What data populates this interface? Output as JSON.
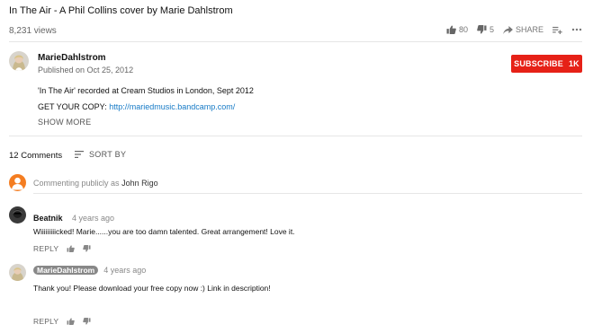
{
  "video": {
    "title": "In The Air - A Phil Collins cover by Marie Dahlstrom",
    "views": "8,231 views",
    "likes": "80",
    "dislikes": "5",
    "share_label": "SHARE",
    "add_icon": "playlist-add-icon",
    "more_icon": "more-horizontal-icon"
  },
  "channel": {
    "name": "MarieDahlstrom",
    "published": "Published on Oct 25, 2012",
    "subscribe_label": "SUBSCRIBE",
    "subscriber_count": "1K",
    "subscribe_color": "#e62117"
  },
  "description": {
    "line1": "'In The Air' recorded at Cream Studios in London, Sept 2012",
    "line2_prefix": "GET YOUR COPY:",
    "line2_link": "http://mariedmusic.bandcamp.com/",
    "link_color": "#167ac6",
    "show_more": "SHOW MORE"
  },
  "comments": {
    "count_label": "12 Comments",
    "sort_label": "SORT BY",
    "commenting_prefix": "Commenting publicly as",
    "commenting_user": "John Rigo",
    "items": [
      {
        "author": "Beatnik",
        "time": "4 years ago",
        "text": "Wiiiiiiiiicked! Marie......you are too damn talented. Great arrangement! Love it.",
        "reply_label": "REPLY"
      },
      {
        "author": "MarieDahlstrom",
        "time": "4 years ago",
        "text": "Thank you! Please download your free copy now :) Link in description!",
        "reply_label": "REPLY"
      }
    ]
  }
}
